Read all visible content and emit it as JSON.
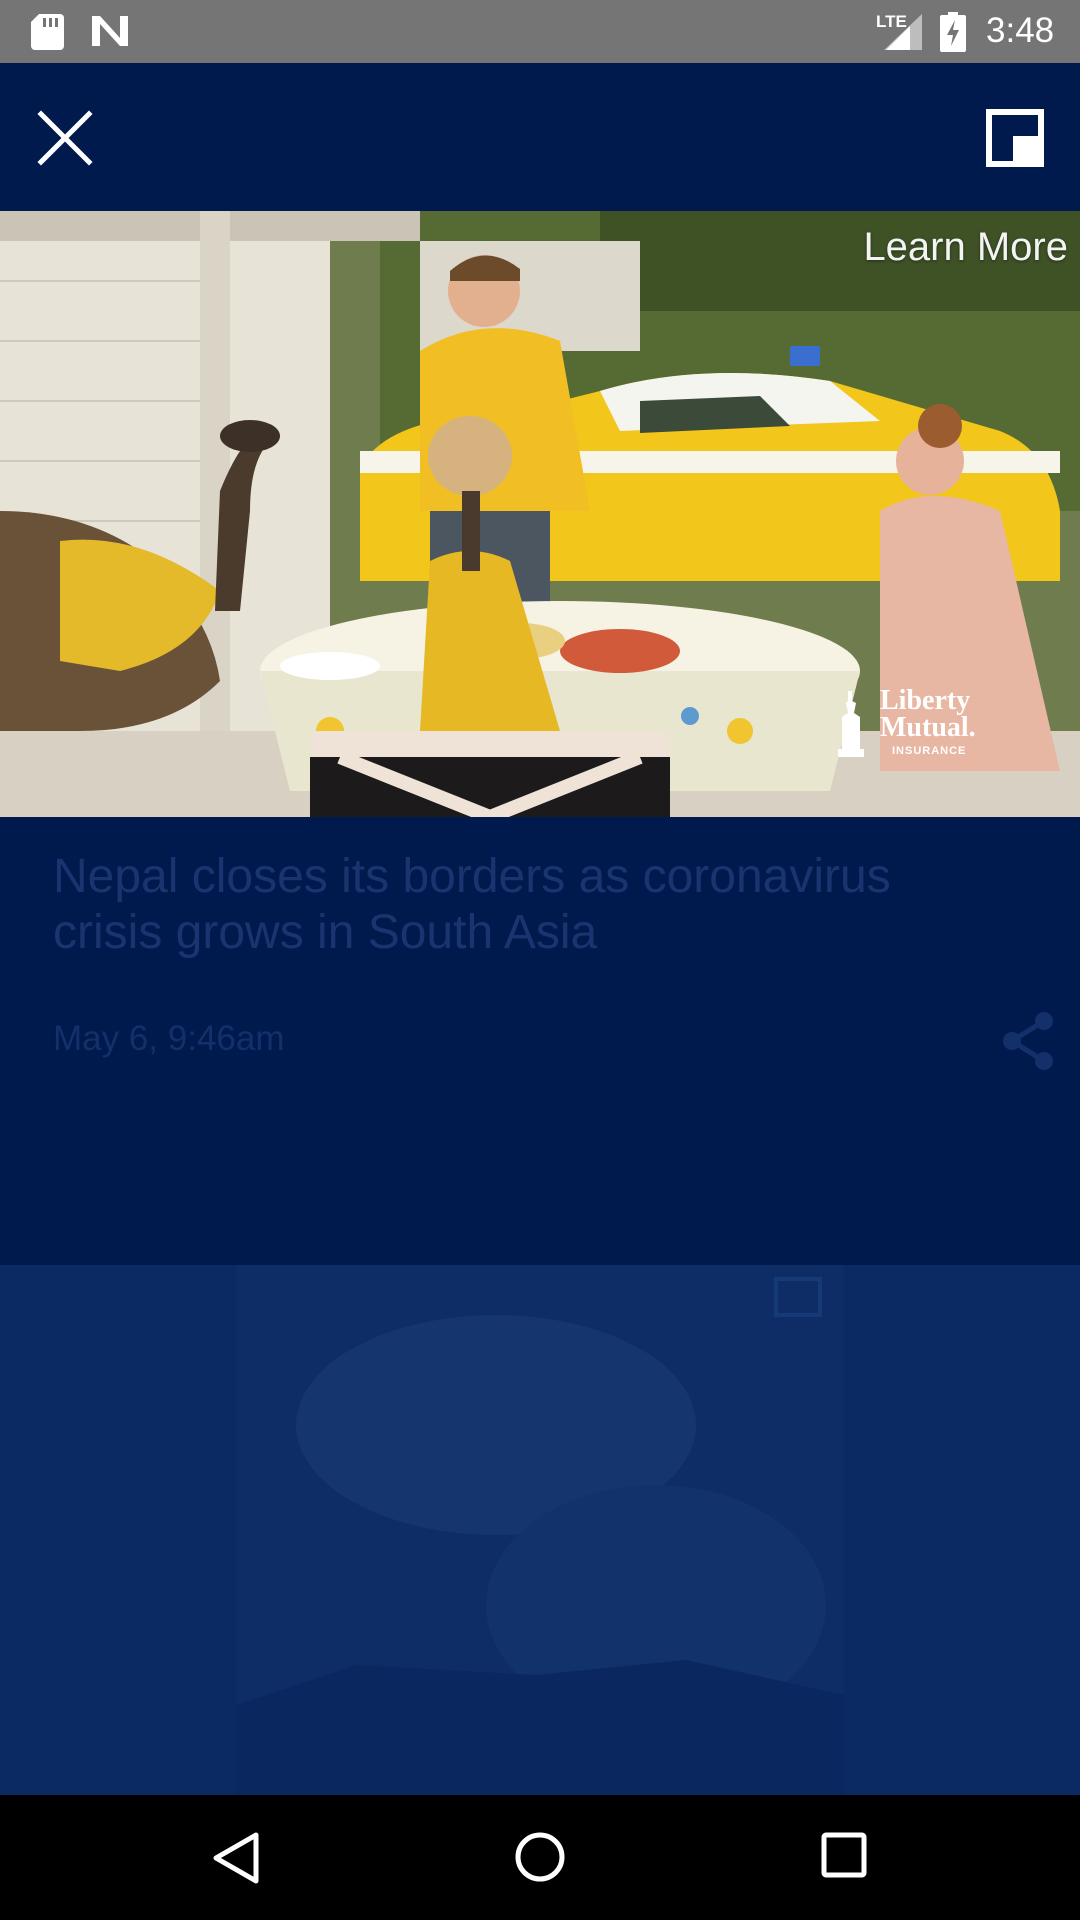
{
  "status_bar": {
    "network": "LTE",
    "time": "3:48",
    "icons": [
      "sd-card-icon",
      "n-icon",
      "signal-icon",
      "battery-charging-icon"
    ]
  },
  "toolbar": {
    "close_icon": "close-icon",
    "pip_icon": "picture-in-picture-icon"
  },
  "ad": {
    "cta_label": "Learn More",
    "brand_name": "Liberty Mutual.",
    "brand_sub": "INSURANCE"
  },
  "article": {
    "headline": "Nepal closes its borders as coronavirus crisis grows in South Asia",
    "timestamp": "May 6, 9:46am",
    "share_icon": "share-icon"
  },
  "nav_bar": {
    "icons": [
      "back-icon",
      "home-icon",
      "recents-icon"
    ]
  },
  "colors": {
    "background": "#001a4d",
    "status_bar": "#757575",
    "dimmed_text": "#1a3470"
  }
}
